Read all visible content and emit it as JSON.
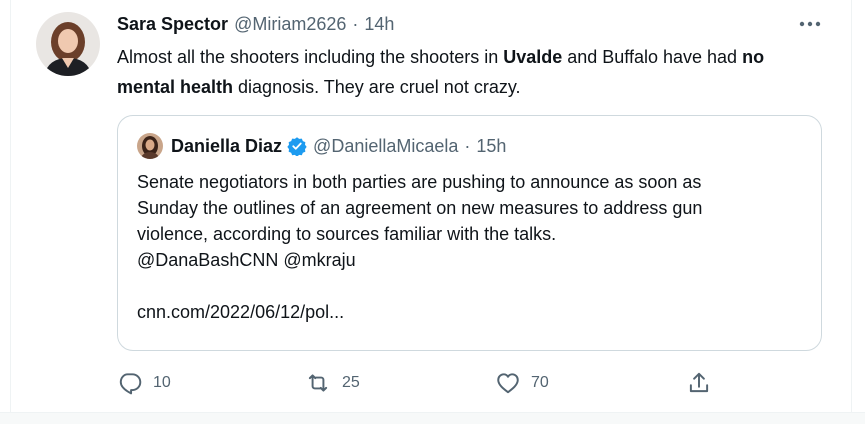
{
  "tweet": {
    "author_name": "Sara Spector",
    "author_handle": "@Miriam2626",
    "separator": "·",
    "time": "14h",
    "text_parts": [
      "Almost all the shooters including the shooters in ",
      "Uvalde",
      " and Buffalo have had ",
      "no mental health",
      " diagnosis. They are cruel not crazy."
    ]
  },
  "quote": {
    "author_name": "Daniella Diaz",
    "author_handle": "@DaniellaMicaela",
    "separator": "·",
    "time": "15h",
    "line1": "Senate negotiators in both parties are pushing to announce as soon as",
    "line2": "Sunday the outlines of an agreement on new measures to address gun",
    "line3": "violence, according to sources familiar with the talks.",
    "line4": "@DanaBashCNN @mkraju",
    "link": "cnn.com/2022/06/12/pol..."
  },
  "actions": {
    "reply_count": "10",
    "retweet_count": "25",
    "like_count": "70"
  },
  "icons": {
    "more": "more-horizontal-icon",
    "verified": "verified-badge-icon",
    "reply": "reply-icon",
    "retweet": "retweet-icon",
    "like": "like-icon",
    "share": "share-icon"
  },
  "colors": {
    "text": "#0f1419",
    "muted": "#536471",
    "border": "#cfd9de",
    "verified": "#1d9bf0"
  }
}
